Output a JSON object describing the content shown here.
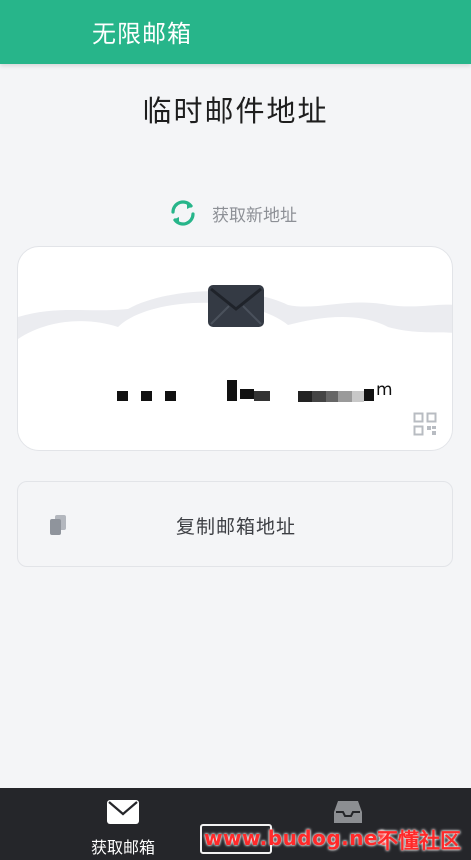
{
  "app_bar": {
    "title": "无限邮箱"
  },
  "page_title": "临时邮件地址",
  "refresh": {
    "label": "获取新地址",
    "icon": "refresh-icon"
  },
  "email_card": {
    "address": "",
    "address_visible_suffix": "m",
    "mail_icon": "envelope-icon",
    "qr_icon": "qr-code-icon"
  },
  "copy_button": {
    "label": "复制邮箱地址",
    "icon": "copy-icon"
  },
  "bottom_nav": {
    "items": [
      {
        "label": "获取邮箱",
        "icon": "envelope-icon",
        "active": true
      },
      {
        "label": "",
        "icon": "inbox-icon",
        "active": false
      }
    ]
  },
  "watermark": {
    "url": "www.budog.net",
    "name": "不懂社区"
  },
  "colors": {
    "accent": "#27b58a",
    "bottom_bar": "#25262a",
    "background": "#f4f5f7",
    "watermark": "#ff2a2a"
  }
}
